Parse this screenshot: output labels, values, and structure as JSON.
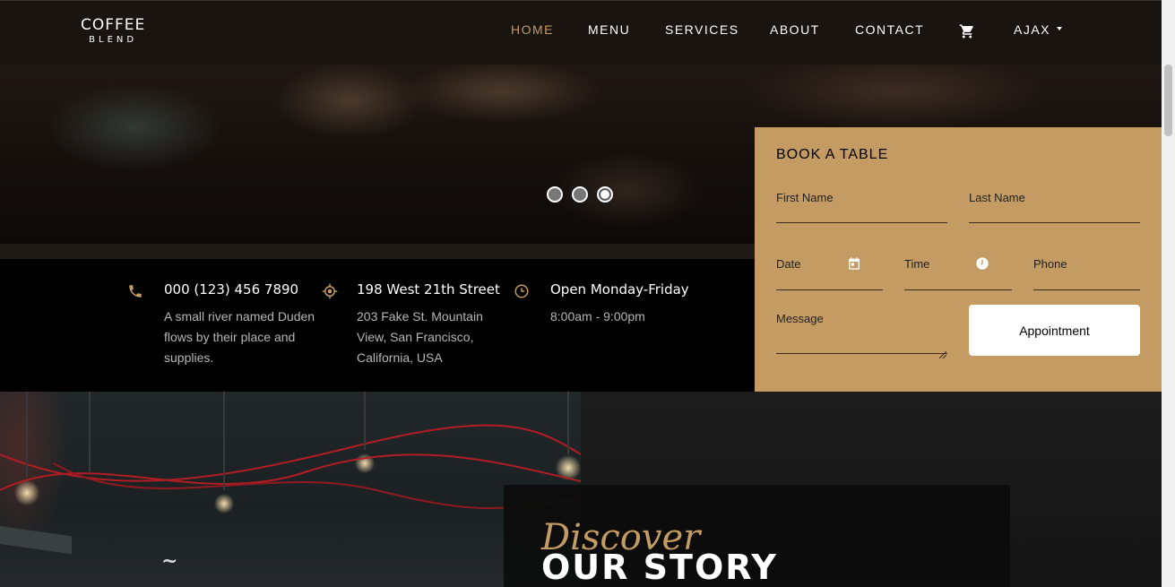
{
  "navbar": {
    "brand_top": "COFFEE",
    "brand_bottom": "BLEND",
    "items": [
      {
        "label": "HOME"
      },
      {
        "label": "MENU"
      },
      {
        "label": "SERVICES"
      },
      {
        "label": "ABOUT"
      },
      {
        "label": "CONTACT"
      }
    ],
    "user": "AJAX",
    "cart_icon": "cart-icon",
    "active_color": "#c49b63"
  },
  "carousel": {
    "slides": 3,
    "active_index": 3
  },
  "info": {
    "phone": {
      "title": "000 (123) 456 7890",
      "text": "A small river named Duden flows by their place and supplies.",
      "icon": "phone-icon"
    },
    "address": {
      "title": "198 West 21th Street",
      "text": "203 Fake St. Mountain View, San Francisco, California, USA",
      "icon": "location-icon"
    },
    "hours": {
      "title": "Open Monday-Friday",
      "text": "8:00am - 9:00pm",
      "icon": "clock-icon"
    }
  },
  "booking": {
    "title": "BOOK A TABLE",
    "first_name": "First Name",
    "last_name": "Last Name",
    "date": "Date",
    "time": "Time",
    "phone": "Phone",
    "message": "Message",
    "button": "Appointment",
    "background": "#c49b63"
  },
  "story": {
    "discover": "Discover",
    "title": "OUR STORY"
  }
}
